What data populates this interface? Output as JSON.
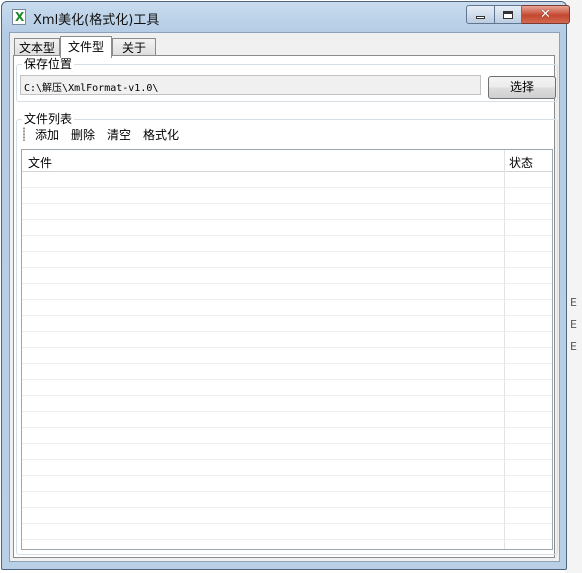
{
  "window": {
    "title": "Xml美化(格式化)工具",
    "app_icon_letter": "X",
    "icon": "xml-app-icon",
    "caption_icons": [
      "minimize-icon",
      "maximize-icon",
      "close-icon"
    ]
  },
  "tabs": [
    {
      "label": "文本型",
      "active": false
    },
    {
      "label": "文件型",
      "active": true
    },
    {
      "label": "关于",
      "active": false
    }
  ],
  "save_location": {
    "group_title": "保存位置",
    "path_value": "C:\\解压\\XmlFormat-v1.0\\",
    "select_label": "选择"
  },
  "file_list": {
    "group_title": "文件列表",
    "toolbar": [
      "添加",
      "删除",
      "清空",
      "格式化"
    ],
    "columns": [
      "文件",
      "状态"
    ],
    "rows": []
  },
  "colors": {
    "title_bar": "#b5cce5",
    "close_button": "#c4472f",
    "panel_background": "#ffffff"
  }
}
